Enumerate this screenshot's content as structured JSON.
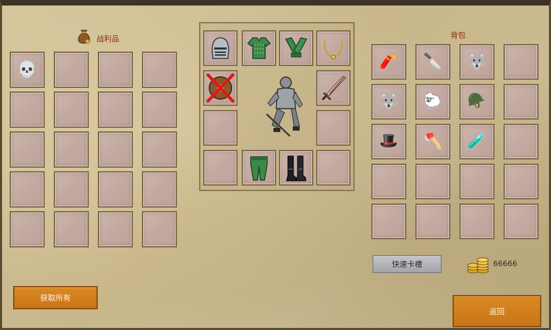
{
  "loot": {
    "title": "战利品",
    "icon": "loot-bag-icon",
    "slots": [
      {
        "icon": "skull-icon",
        "glyph": "💀"
      },
      {
        "icon": "",
        "glyph": ""
      },
      {
        "icon": "",
        "glyph": ""
      },
      {
        "icon": "",
        "glyph": ""
      },
      {
        "icon": "",
        "glyph": ""
      },
      {
        "icon": "",
        "glyph": ""
      },
      {
        "icon": "",
        "glyph": ""
      },
      {
        "icon": "",
        "glyph": ""
      },
      {
        "icon": "",
        "glyph": ""
      },
      {
        "icon": "",
        "glyph": ""
      },
      {
        "icon": "",
        "glyph": ""
      },
      {
        "icon": "",
        "glyph": ""
      },
      {
        "icon": "",
        "glyph": ""
      },
      {
        "icon": "",
        "glyph": ""
      },
      {
        "icon": "",
        "glyph": ""
      },
      {
        "icon": "",
        "glyph": ""
      },
      {
        "icon": "",
        "glyph": ""
      },
      {
        "icon": "",
        "glyph": ""
      },
      {
        "icon": "",
        "glyph": ""
      },
      {
        "icon": "",
        "glyph": ""
      }
    ],
    "collect_all_label": "获取所有"
  },
  "equipment": {
    "character": "knight-figure-icon",
    "slots": {
      "head": "helmet-icon",
      "body": "green-chainmail-icon",
      "hands": "green-gloves-icon",
      "neck": "gold-necklace-icon",
      "offhand": "disabled-shield-icon",
      "weapon": "sword-icon",
      "legs": "green-leg-armor-icon",
      "feet": "black-boots-icon"
    }
  },
  "backpack": {
    "title": "背包",
    "slots": [
      {
        "icon": "red-scroll-icon",
        "glyph": "🧨"
      },
      {
        "icon": "curved-knife-icon",
        "glyph": "🔪"
      },
      {
        "icon": "gray-fur-icon",
        "glyph": "🐺"
      },
      {
        "icon": "",
        "glyph": ""
      },
      {
        "icon": "gray-fur-icon",
        "glyph": "🐺"
      },
      {
        "icon": "white-fur-icon",
        "glyph": "🐑"
      },
      {
        "icon": "green-helmet-icon",
        "glyph": "🪖"
      },
      {
        "icon": "",
        "glyph": ""
      },
      {
        "icon": "blue-green-hat-icon",
        "glyph": "🎩"
      },
      {
        "icon": "battle-axe-icon",
        "glyph": "🪓"
      },
      {
        "icon": "red-potion-icon",
        "glyph": "🧪"
      },
      {
        "icon": "",
        "glyph": ""
      },
      {
        "icon": "",
        "glyph": ""
      },
      {
        "icon": "",
        "glyph": ""
      },
      {
        "icon": "",
        "glyph": ""
      },
      {
        "icon": "",
        "glyph": ""
      },
      {
        "icon": "",
        "glyph": ""
      },
      {
        "icon": "",
        "glyph": ""
      },
      {
        "icon": "",
        "glyph": ""
      },
      {
        "icon": "",
        "glyph": ""
      }
    ],
    "quick_slot_label": "快速卡槽"
  },
  "currency": {
    "icon": "gold-coins-icon",
    "amount": "66666"
  },
  "back_label": "返回"
}
